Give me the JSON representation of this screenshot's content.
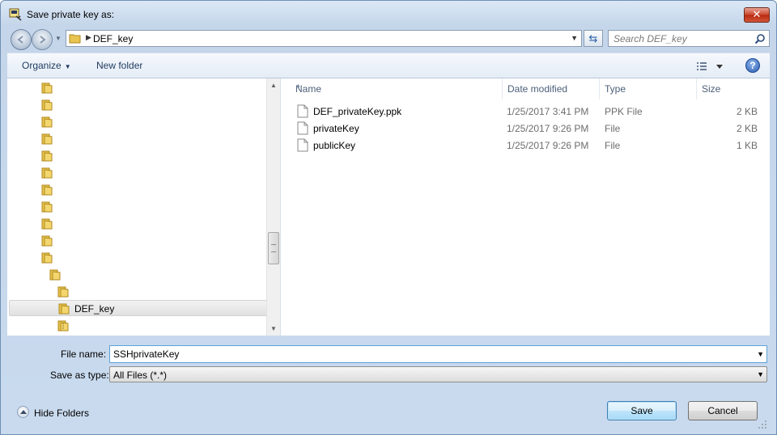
{
  "window": {
    "title": "Save private key as:",
    "close_label": "✕"
  },
  "address": {
    "path_segment": "DEF_key",
    "search_placeholder": "Search DEF_key"
  },
  "toolbar": {
    "organize_label": "Organize",
    "new_folder_label": "New folder",
    "help_label": "?"
  },
  "navigation": {
    "selected_folder": "DEF_key"
  },
  "file_list": {
    "columns": [
      "Name",
      "Date modified",
      "Type",
      "Size"
    ],
    "rows": [
      {
        "name": "DEF_privateKey.ppk",
        "date": "1/25/2017 3:41 PM",
        "type": "PPK File",
        "size": "2 KB"
      },
      {
        "name": "privateKey",
        "date": "1/25/2017 9:26 PM",
        "type": "File",
        "size": "2 KB"
      },
      {
        "name": "publicKey",
        "date": "1/25/2017 9:26 PM",
        "type": "File",
        "size": "1 KB"
      }
    ]
  },
  "form": {
    "file_name_label": "File name:",
    "file_name_value": "SSHprivateKey",
    "save_type_label": "Save as type:",
    "save_type_value": "All Files (*.*)"
  },
  "footer": {
    "hide_folders_label": "Hide Folders",
    "save_label": "Save",
    "cancel_label": "Cancel"
  },
  "colors": {
    "accent": "#3c7fb1",
    "folder": "#e8c450",
    "close": "#c9452c"
  }
}
